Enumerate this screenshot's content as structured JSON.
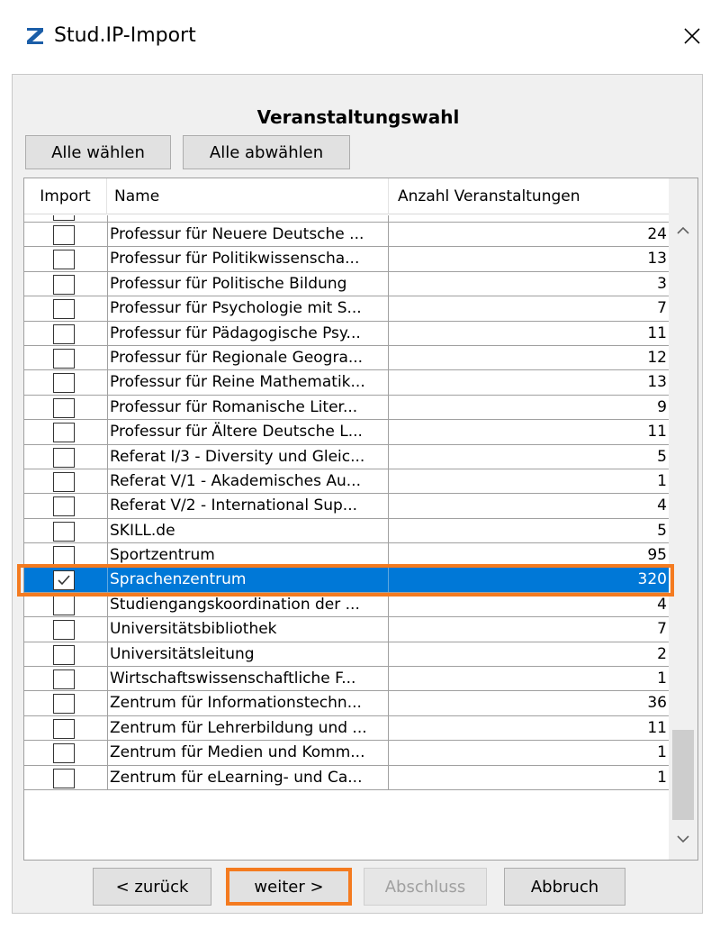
{
  "window": {
    "title": "Stud.IP-Import"
  },
  "section_title": "Veranstaltungswahl",
  "buttons": {
    "select_all": "Alle wählen",
    "deselect_all": "Alle abwählen",
    "back": "< zurück",
    "next": "weiter >",
    "finish": "Abschluss",
    "cancel": "Abbruch"
  },
  "table": {
    "headers": {
      "import": "Import",
      "name": "Name",
      "count": "Anzahl Veranstaltungen"
    },
    "rows": [
      {
        "name": "Professur für Neuere Deutsche ...",
        "count": "24",
        "checked": false,
        "selected": false
      },
      {
        "name": "Professur für Politikwissenscha...",
        "count": "13",
        "checked": false,
        "selected": false
      },
      {
        "name": "Professur für Politische Bildung",
        "count": "3",
        "checked": false,
        "selected": false
      },
      {
        "name": "Professur für Psychologie mit S...",
        "count": "7",
        "checked": false,
        "selected": false
      },
      {
        "name": "Professur für Pädagogische Psy...",
        "count": "11",
        "checked": false,
        "selected": false
      },
      {
        "name": "Professur für Regionale Geogra...",
        "count": "12",
        "checked": false,
        "selected": false
      },
      {
        "name": "Professur für Reine Mathematik...",
        "count": "13",
        "checked": false,
        "selected": false
      },
      {
        "name": "Professur für Romanische Liter...",
        "count": "9",
        "checked": false,
        "selected": false
      },
      {
        "name": "Professur für Ältere Deutsche L...",
        "count": "11",
        "checked": false,
        "selected": false
      },
      {
        "name": "Referat I/3 - Diversity und Gleic...",
        "count": "5",
        "checked": false,
        "selected": false
      },
      {
        "name": "Referat V/1 - Akademisches Au...",
        "count": "1",
        "checked": false,
        "selected": false
      },
      {
        "name": "Referat V/2 - International Sup...",
        "count": "4",
        "checked": false,
        "selected": false
      },
      {
        "name": "SKILL.de",
        "count": "5",
        "checked": false,
        "selected": false
      },
      {
        "name": "Sportzentrum",
        "count": "95",
        "checked": false,
        "selected": false
      },
      {
        "name": "Sprachenzentrum",
        "count": "320",
        "checked": true,
        "selected": true
      },
      {
        "name": "Studiengangskoordination der ...",
        "count": "4",
        "checked": false,
        "selected": false
      },
      {
        "name": "Universitätsbibliothek",
        "count": "7",
        "checked": false,
        "selected": false
      },
      {
        "name": "Universitätsleitung",
        "count": "2",
        "checked": false,
        "selected": false
      },
      {
        "name": "Wirtschaftswissenschaftliche F...",
        "count": "1",
        "checked": false,
        "selected": false
      },
      {
        "name": "Zentrum für Informationstechn...",
        "count": "36",
        "checked": false,
        "selected": false
      },
      {
        "name": "Zentrum für Lehrerbildung und ...",
        "count": "11",
        "checked": false,
        "selected": false
      },
      {
        "name": "Zentrum für Medien und Komm...",
        "count": "1",
        "checked": false,
        "selected": false
      },
      {
        "name": "Zentrum für eLearning- und Ca...",
        "count": "1",
        "checked": false,
        "selected": false
      }
    ]
  },
  "icons": {
    "app": "zotero-z-icon",
    "close": "close-icon",
    "check": "checkmark-icon",
    "scroll_up": "chevron-up-icon",
    "scroll_down": "chevron-down-icon"
  },
  "colors": {
    "selection": "#0078d7",
    "highlight_outline": "#f47b20",
    "app_icon": "#1b5ea8"
  }
}
